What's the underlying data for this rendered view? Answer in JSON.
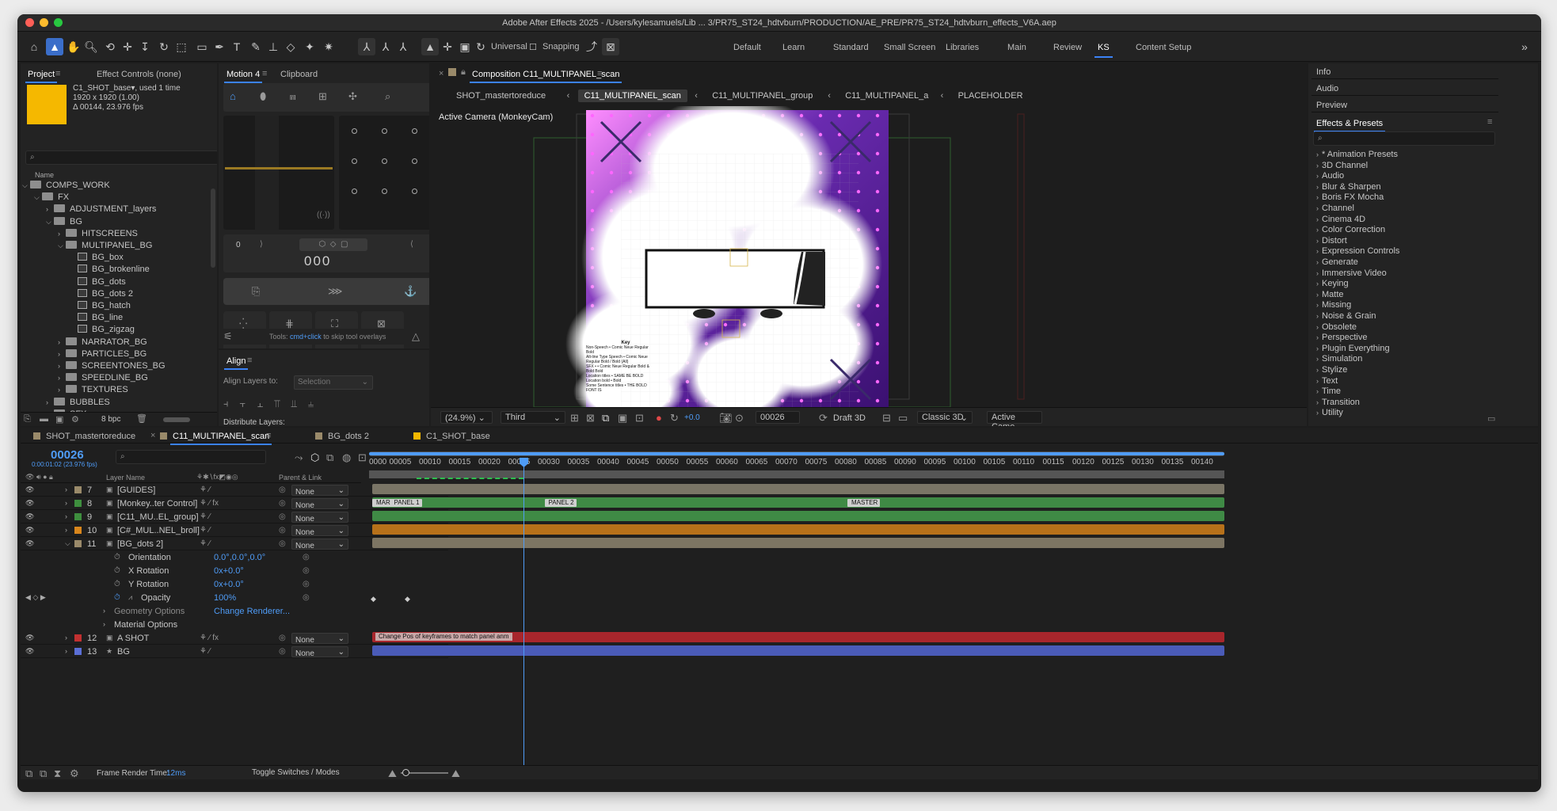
{
  "window": {
    "title": "Adobe After Effects 2025 - /Users/kylesamuels/Lib ... 3/PR75_ST24_hdtvburn/PRODUCTION/AE_PRE/PR75_ST24_hdtvburn_effects_V6A.aep"
  },
  "toolbar": {
    "universal": "Universal",
    "snapping": "Snapping"
  },
  "workspaces": [
    "Default",
    "Learn",
    "Standard",
    "Small Screen",
    "Libraries",
    "Main",
    "Review",
    "KS",
    "Content Setup"
  ],
  "active_workspace": "KS",
  "project": {
    "tab_project": "Project",
    "tab_effects": "Effect Controls (none)",
    "item_name": "C1_SHOT_base▾",
    "item_used": ", used 1 time",
    "item_size": "1920 x 1920 (1.00)",
    "item_duration": "Δ 00144, 23.976 fps",
    "thumb_color": "#f5b800",
    "col_name": "Name",
    "tree": [
      {
        "label": "COMPS_WORK",
        "indent": 0,
        "type": "folder",
        "open": true
      },
      {
        "label": "FX",
        "indent": 1,
        "type": "folder",
        "open": true
      },
      {
        "label": "ADJUSTMENT_layers",
        "indent": 2,
        "type": "folder",
        "open": false
      },
      {
        "label": "BG",
        "indent": 2,
        "type": "folder",
        "open": true
      },
      {
        "label": "HITSCREENS",
        "indent": 3,
        "type": "folder",
        "open": false
      },
      {
        "label": "MULTIPANEL_BG",
        "indent": 3,
        "type": "folder",
        "open": true
      },
      {
        "label": "BG_box",
        "indent": 4,
        "type": "comp"
      },
      {
        "label": "BG_brokenline",
        "indent": 4,
        "type": "comp"
      },
      {
        "label": "BG_dots",
        "indent": 4,
        "type": "comp"
      },
      {
        "label": "BG_dots 2",
        "indent": 4,
        "type": "comp"
      },
      {
        "label": "BG_hatch",
        "indent": 4,
        "type": "comp"
      },
      {
        "label": "BG_line",
        "indent": 4,
        "type": "comp"
      },
      {
        "label": "BG_zigzag",
        "indent": 4,
        "type": "comp"
      },
      {
        "label": "NARRATOR_BG",
        "indent": 3,
        "type": "folder",
        "open": false
      },
      {
        "label": "PARTICLES_BG",
        "indent": 3,
        "type": "folder",
        "open": false
      },
      {
        "label": "SCREENTONES_BG",
        "indent": 3,
        "type": "folder",
        "open": false
      },
      {
        "label": "SPEEDLINE_BG",
        "indent": 3,
        "type": "folder",
        "open": false
      },
      {
        "label": "TEXTURES",
        "indent": 3,
        "type": "folder",
        "open": false
      },
      {
        "label": "BUBBLES",
        "indent": 2,
        "type": "folder",
        "open": false
      },
      {
        "label": "SFX",
        "indent": 2,
        "type": "folder",
        "open": false
      }
    ],
    "bpc": "8 bpc"
  },
  "motion": {
    "tab_motion": "Motion 4",
    "tab_clipboard": "Clipboard",
    "left_val": "0",
    "right_val": "0",
    "center_val": "000",
    "buttons": [
      "Grab",
      "Animo",
      "Null",
      "Texture"
    ],
    "tools_hint_prefix": "Tools: ",
    "tools_hint_key": "cmd+click",
    "tools_hint_suffix": " to skip tool overlays",
    "slider_level": 0.45
  },
  "align": {
    "title": "Align",
    "align_to_label": "Align Layers to:",
    "align_to_value": "Selection",
    "distribute": "Distribute Layers:"
  },
  "composition": {
    "tab": "Composition C11_MULTIPANEL_scan",
    "breadcrumbs": [
      "SHOT_mastertoreduce",
      "C11_MULTIPANEL_scan",
      "C11_MULTIPANEL_group",
      "C11_MULTIPANEL_a",
      "PLACEHOLDER"
    ],
    "active_crumb": "C11_MULTIPANEL_scan",
    "camera_label": "Active Camera (MonkeyCam)",
    "key_title": "Key",
    "key_lines": [
      "Non-Speech • Comic Neue Regular",
      "Bold",
      "Alt-line Type Speech • Comic Neue",
      "Regular Bold / Bold (All)",
      "SFX • • Comic Neue Regular Bold &",
      "Bold Bold",
      "Location titles • SAME BE BOLD",
      "Location bold • Bold",
      "Some Sentence titles • THE BOLD",
      "FONT IS"
    ],
    "bottom": {
      "zoom": "(24.9%)",
      "view": "Third",
      "exposure": "+0.0",
      "frame": "00026",
      "draft": "Draft 3D",
      "renderer": "Classic 3D",
      "camera": "Active Came..."
    }
  },
  "right_panels": {
    "info": "Info",
    "audio": "Audio",
    "preview": "Preview",
    "effects_title": "Effects & Presets",
    "effects": [
      "* Animation Presets",
      "3D Channel",
      "Audio",
      "Blur & Sharpen",
      "Boris FX Mocha",
      "Channel",
      "Cinema 4D",
      "Color Correction",
      "Distort",
      "Expression Controls",
      "Generate",
      "Immersive Video",
      "Keying",
      "Matte",
      "Missing",
      "Noise & Grain",
      "Obsolete",
      "Perspective",
      "Plugin Everything",
      "Simulation",
      "Stylize",
      "Text",
      "Time",
      "Transition",
      "Utility"
    ]
  },
  "timeline": {
    "tabs": [
      "SHOT_mastertoreduce",
      "C11_MULTIPANEL_scan",
      "BG_dots 2",
      "C1_SHOT_base"
    ],
    "active_tab": "C11_MULTIPANEL_scan",
    "timecode": "00026",
    "timecode_sub": "0:00:01:02 (23.976 fps)",
    "col_layer_name": "Layer Name",
    "col_parent": "Parent & Link",
    "ruler": [
      "0000",
      "00005",
      "00010",
      "00015",
      "00020",
      "00025",
      "00030",
      "00035",
      "00040",
      "00045",
      "00050",
      "00055",
      "00060",
      "00065",
      "00070",
      "00075",
      "00080",
      "00085",
      "00090",
      "00095",
      "00100",
      "00105",
      "00110",
      "00115",
      "00120",
      "00125",
      "00130",
      "00135",
      "00140"
    ],
    "playhead_frame": 26,
    "total_frames": 144,
    "layers": [
      {
        "num": "7",
        "name": "[GUIDES]",
        "color": "#9a8a6a",
        "parent": "None",
        "bar_color": "#7a7566"
      },
      {
        "num": "8",
        "name": "[Monkey..ter Control]",
        "color": "#3e8e3e",
        "parent": "None",
        "bar_color": "#3f8a45"
      },
      {
        "num": "9",
        "name": "[C11_MU..EL_group]",
        "color": "#3e8e3e",
        "parent": "None",
        "bar_color": "#3f8a45"
      },
      {
        "num": "10",
        "name": "[C#_MUL..NEL_broll]",
        "color": "#d9861c",
        "parent": "None",
        "bar_color": "#b7711a"
      },
      {
        "num": "11",
        "name": "[BG_dots 2]",
        "color": "#9a8a6a",
        "parent": "None",
        "bar_color": "#7d7563"
      }
    ],
    "props": [
      {
        "name": "Orientation",
        "value": "0.0°,0.0°,0.0°"
      },
      {
        "name": "X Rotation",
        "value": "0x+0.0°"
      },
      {
        "name": "Y Rotation",
        "value": "0x+0.0°"
      },
      {
        "name": "Opacity",
        "value": "100%"
      }
    ],
    "geometry": "Geometry Options",
    "change_renderer": "Change Renderer...",
    "material": "Material Options",
    "layers2": [
      {
        "num": "12",
        "name": "A SHOT",
        "color": "#c23030",
        "parent": "None",
        "bar_color": "#a8262c"
      },
      {
        "num": "13",
        "name": "BG",
        "color": "#5b6fd6",
        "parent": "None",
        "bar_color": "#4a5bb8"
      }
    ],
    "markers": [
      {
        "label": "MARKER",
        "frame": 0
      },
      {
        "label": "PANEL 1",
        "frame": 3
      },
      {
        "label": "PANEL 2",
        "frame": 29
      },
      {
        "label": "MASTER",
        "frame": 80
      }
    ],
    "ashot_comment": "Change Pos of keyframes to match panel anm",
    "frame_render_label": "Frame Render Time:",
    "frame_render_value": "12ms",
    "toggle": "Toggle Switches / Modes"
  }
}
